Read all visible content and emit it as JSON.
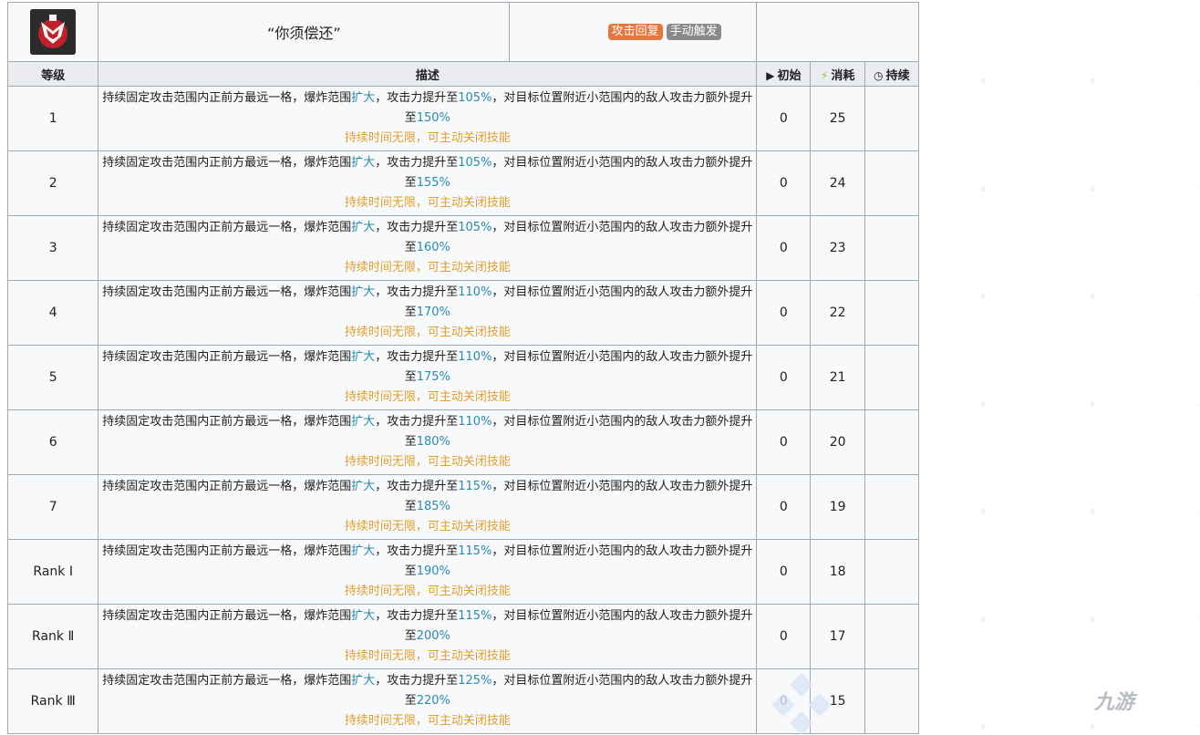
{
  "skill": {
    "name": "“你须偿还”",
    "tags": [
      {
        "label": "攻击回复",
        "color": "#e8763a"
      },
      {
        "label": "手动触发",
        "color": "#8a8a8a"
      }
    ]
  },
  "headers": {
    "level": "等级",
    "desc": "描述",
    "init": "初始",
    "cost": "消耗",
    "duration": "持续"
  },
  "desc_parts": {
    "p1": "持续固定攻击范围内正前方最远一格，爆炸范围",
    "expand": "扩大",
    "p2": "，攻击力提升至",
    "p3": "，对目标位置附近小范围内的敌人攻击力额外提升至",
    "note": "持续时间无限，可主动关闭技能"
  },
  "rows": [
    {
      "level": "1",
      "atk": "105%",
      "extra": "150%",
      "init": "0",
      "cost": "25",
      "duration": ""
    },
    {
      "level": "2",
      "atk": "105%",
      "extra": "155%",
      "init": "0",
      "cost": "24",
      "duration": ""
    },
    {
      "level": "3",
      "atk": "105%",
      "extra": "160%",
      "init": "0",
      "cost": "23",
      "duration": ""
    },
    {
      "level": "4",
      "atk": "110%",
      "extra": "170%",
      "init": "0",
      "cost": "22",
      "duration": ""
    },
    {
      "level": "5",
      "atk": "110%",
      "extra": "175%",
      "init": "0",
      "cost": "21",
      "duration": ""
    },
    {
      "level": "6",
      "atk": "110%",
      "extra": "180%",
      "init": "0",
      "cost": "20",
      "duration": ""
    },
    {
      "level": "7",
      "atk": "115%",
      "extra": "185%",
      "init": "0",
      "cost": "19",
      "duration": ""
    },
    {
      "level": "Rank Ⅰ",
      "atk": "115%",
      "extra": "190%",
      "init": "0",
      "cost": "18",
      "duration": ""
    },
    {
      "level": "Rank Ⅱ",
      "atk": "115%",
      "extra": "200%",
      "init": "0",
      "cost": "17",
      "duration": ""
    },
    {
      "level": "Rank Ⅲ",
      "atk": "125%",
      "extra": "220%",
      "init": "0",
      "cost": "15",
      "duration": ""
    }
  ],
  "watermark": "九游",
  "icons": {
    "skill": "skill-emblem-icon",
    "init": "play-triangle-icon",
    "cost": "lightning-bolt-icon",
    "duration": "clock-icon"
  },
  "colors": {
    "highlight": "#2a8bb0",
    "note": "#e0a030",
    "cost_icon": "#8ac33a"
  }
}
